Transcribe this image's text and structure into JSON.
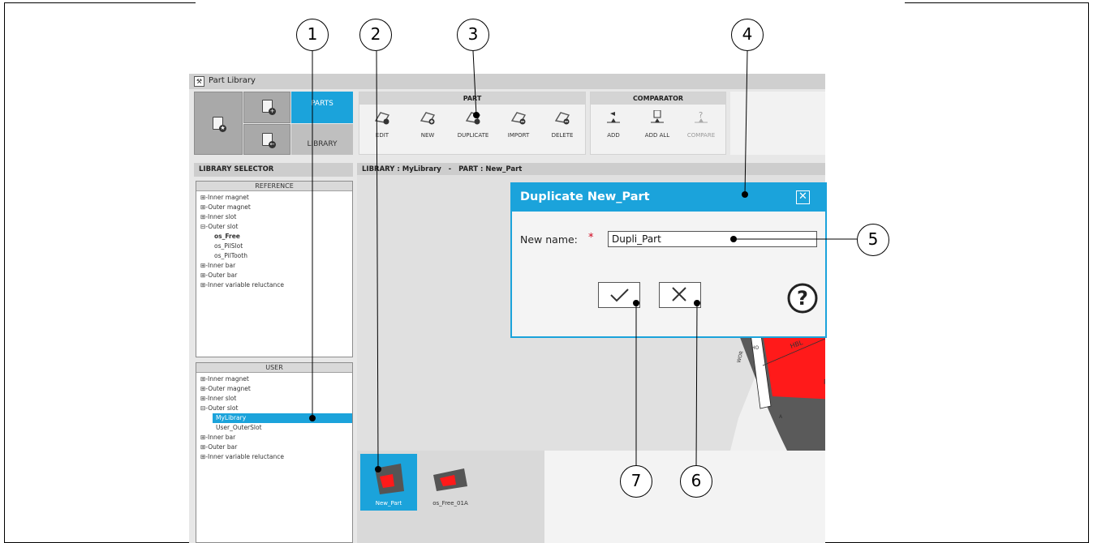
{
  "window": {
    "title": "Part Library"
  },
  "nav": {
    "parts_tab": "PARTS",
    "library_tab": "LIBRARY"
  },
  "toolbar": {
    "part_group": "PART",
    "part_tools": [
      {
        "label": "EDIT",
        "icon": "edit-part-icon"
      },
      {
        "label": "NEW",
        "icon": "new-part-icon"
      },
      {
        "label": "DUPLICATE",
        "icon": "duplicate-part-icon"
      },
      {
        "label": "IMPORT",
        "icon": "import-part-icon"
      },
      {
        "label": "DELETE",
        "icon": "delete-part-icon"
      }
    ],
    "comparator_group": "COMPARATOR",
    "comparator_tools": [
      {
        "label": "ADD",
        "icon": "add-compare-icon"
      },
      {
        "label": "ADD ALL",
        "icon": "add-all-compare-icon"
      },
      {
        "label": "COMPARE",
        "icon": "compare-icon",
        "disabled": true
      }
    ]
  },
  "library_selector": {
    "header": "LIBRARY SELECTOR",
    "reference": {
      "title": "REFERENCE",
      "items": [
        "⊞-Inner magnet",
        "⊞-Outer magnet",
        "⊞-Inner slot",
        "⊟-Outer slot",
        "os_Free",
        "os_PilSlot",
        "os_PilTooth",
        "⊞-Inner bar",
        "⊞-Outer bar",
        "⊞-Inner variable reluctance"
      ]
    },
    "user": {
      "title": "USER",
      "items": [
        "⊞-Inner magnet",
        "⊞-Outer magnet",
        "⊞-Inner slot",
        "⊟-Outer slot",
        "MyLibrary",
        "User_OuterSlot",
        "⊞-Inner bar",
        "⊞-Outer bar",
        "⊞-Inner variable reluctance"
      ]
    }
  },
  "breadcrumb": "LIBRARY : MyLibrary   -   PART : New_Part",
  "gallery": {
    "thumbnails": [
      {
        "label": "New_Part",
        "selected": true
      },
      {
        "label": "os_Free_01A",
        "selected": false
      }
    ]
  },
  "viewer_dims": {
    "hbl": "HBL",
    "r": "R",
    "wor": "WOR",
    "ho": "HO",
    "a": "A"
  },
  "dialog": {
    "title": "Duplicate New_Part",
    "name_label": "New name:",
    "required_mark": "*",
    "name_value": "Dupli_Part",
    "ok_icon": "checkmark-icon",
    "cancel_icon": "cross-icon",
    "help_icon": "help-icon"
  },
  "callouts": [
    "1",
    "2",
    "3",
    "4",
    "5",
    "6",
    "7"
  ],
  "colors": {
    "accent": "#1ba3db",
    "magnet": "#ff1a1a",
    "stator": "#5a5a5a"
  }
}
